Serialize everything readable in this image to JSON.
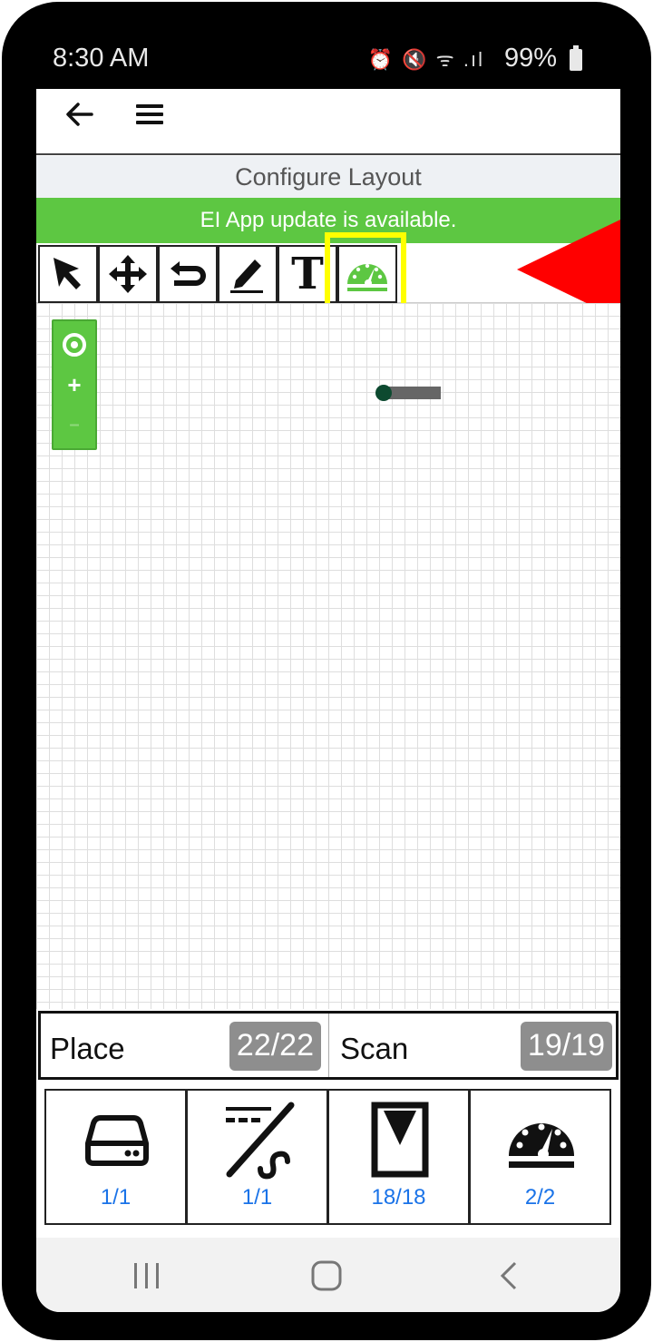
{
  "status_bar": {
    "time": "8:30 AM",
    "icons": "⏰ 🔇 ᯤ .ıl",
    "battery": "99%"
  },
  "header": {
    "back_icon": "arrow-left-icon",
    "menu_icon": "hamburger-menu-icon"
  },
  "page": {
    "title": "Configure Layout"
  },
  "banner": {
    "text": "EI App update is available."
  },
  "toolbar": {
    "tools": [
      {
        "name": "select-arrow",
        "icon": "cursor-arrow-icon"
      },
      {
        "name": "move",
        "icon": "move-cross-icon"
      },
      {
        "name": "undo",
        "icon": "undo-icon"
      },
      {
        "name": "draw",
        "icon": "pencil-icon"
      },
      {
        "name": "text",
        "label": "T"
      },
      {
        "name": "gauge",
        "icon": "gauge-icon",
        "selected": true
      }
    ]
  },
  "zoom": {
    "center_icon": "target-icon",
    "zoom_in": "+",
    "zoom_out": "–"
  },
  "counters": {
    "place_label": "Place",
    "place_value": "22/22",
    "scan_label": "Scan",
    "scan_value": "19/19"
  },
  "devices": [
    {
      "icon": "hard-drive-icon",
      "count": "1/1"
    },
    {
      "icon": "wire-cut-icon",
      "count": "1/1"
    },
    {
      "icon": "window-sensor-icon",
      "count": "18/18"
    },
    {
      "icon": "gauge-icon",
      "count": "2/2"
    }
  ],
  "colors": {
    "accent_green": "#5dc742",
    "highlight_yellow": "#ffff00",
    "pointer_red": "#ff0000",
    "count_blue": "#1a73e8",
    "badge_gray": "#8e8e8e"
  }
}
